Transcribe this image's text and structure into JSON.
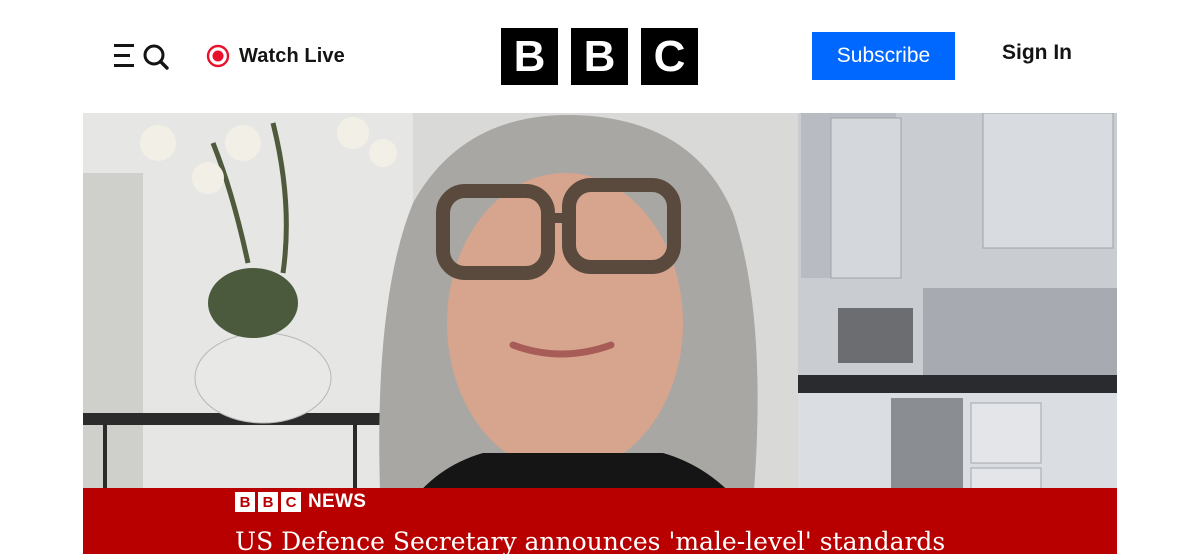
{
  "header": {
    "menu_icon": "menu-search-icon",
    "watch_live_label": "Watch Live",
    "live_icon": "live-record-dot-icon",
    "logo_letters": [
      "B",
      "B",
      "C"
    ],
    "subscribe_label": "Subscribe",
    "sign_in_label": "Sign In",
    "colors": {
      "subscribe_bg": "#0068ff",
      "live_dot": "#e8102b",
      "logo_bg": "#000000"
    }
  },
  "video": {
    "lower_third": {
      "brand_letters": [
        "B",
        "B",
        "C"
      ],
      "brand_name": "NEWS",
      "headline": "US Defence Secretary announces 'male-level' standards",
      "color": "#b80000"
    }
  }
}
